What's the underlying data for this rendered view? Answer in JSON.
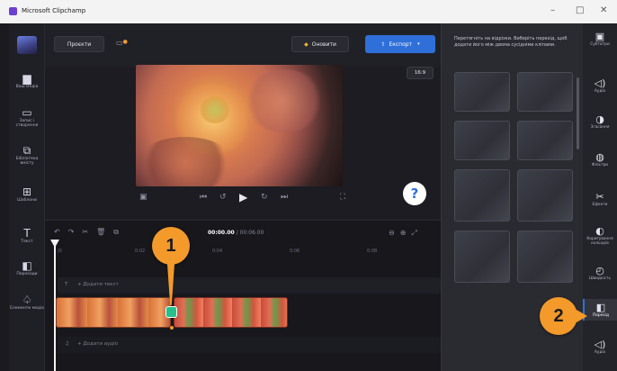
{
  "window": {
    "title": "Microsoft Clipchamp",
    "min_glyph": "–",
    "max_glyph": "□",
    "close_glyph": "✕"
  },
  "left_nav": [
    {
      "icon": "folder-icon",
      "glyph": "▆",
      "label": "Ваш медіа"
    },
    {
      "icon": "camera-icon",
      "glyph": "▭",
      "label": "Запис і створення"
    },
    {
      "icon": "content-library-icon",
      "glyph": "⧉",
      "label": "Бібліотека вмісту"
    },
    {
      "icon": "templates-icon",
      "glyph": "⊞",
      "label": "Шаблони"
    },
    {
      "icon": "text-icon",
      "glyph": "T",
      "label": "Текст"
    },
    {
      "icon": "transitions-icon",
      "glyph": "◧",
      "label": "Переходи"
    },
    {
      "icon": "brand-kit-icon",
      "glyph": "♤",
      "label": "Елементи медіа"
    }
  ],
  "topbar": {
    "project_tab": "Проєкти",
    "upgrade_label": "Оновити",
    "upgrade_glyph": "◆",
    "export_label": "Експорт",
    "export_glyph": "⇧",
    "aspect_ratio": "16:9"
  },
  "player": {
    "prev_glyph": "⏮",
    "back_glyph": "↺",
    "play_glyph": "▶",
    "fwd_glyph": "↻",
    "next_glyph": "⏭",
    "help_glyph": "?"
  },
  "timeline": {
    "time_current": "00:00.00",
    "time_total": "00:06.00",
    "ruler": [
      "|0",
      "0:02",
      "0:04",
      "0:06",
      "0:08"
    ],
    "text_track_hint": "+ Додати текст",
    "audio_track_hint": "+ Додати аудіо"
  },
  "transitions_panel": {
    "hint": "Перетягніть на відрізки. Виберіть перехід, щоб додати його між двома сусідніми кліпами."
  },
  "right_nav": [
    {
      "icon": "captions-icon",
      "glyph": "▣",
      "label": "Субтитри"
    },
    {
      "icon": "audio-icon",
      "glyph": "◁)",
      "label": "Аудіо"
    },
    {
      "icon": "fade-icon",
      "glyph": "◑",
      "label": "Згасання"
    },
    {
      "icon": "filters-icon",
      "glyph": "◍",
      "label": "Фільтри"
    },
    {
      "icon": "effects-icon",
      "glyph": "✂",
      "label": "Ефекти"
    },
    {
      "icon": "adjust-colors-icon",
      "glyph": "◐",
      "label": "Коригування кольорів"
    },
    {
      "icon": "speed-icon",
      "glyph": "◴",
      "label": "Швидкість"
    },
    {
      "icon": "transition-icon",
      "glyph": "◧",
      "label": "Перехід"
    },
    {
      "icon": "audio2-icon",
      "glyph": "◁)",
      "label": "Аудіо"
    }
  ],
  "callouts": {
    "one": "1",
    "two": "2"
  },
  "colors": {
    "accent_blue": "#2f6fd9",
    "callout_orange": "#f39a2b",
    "clip_green": "#27c08a"
  }
}
